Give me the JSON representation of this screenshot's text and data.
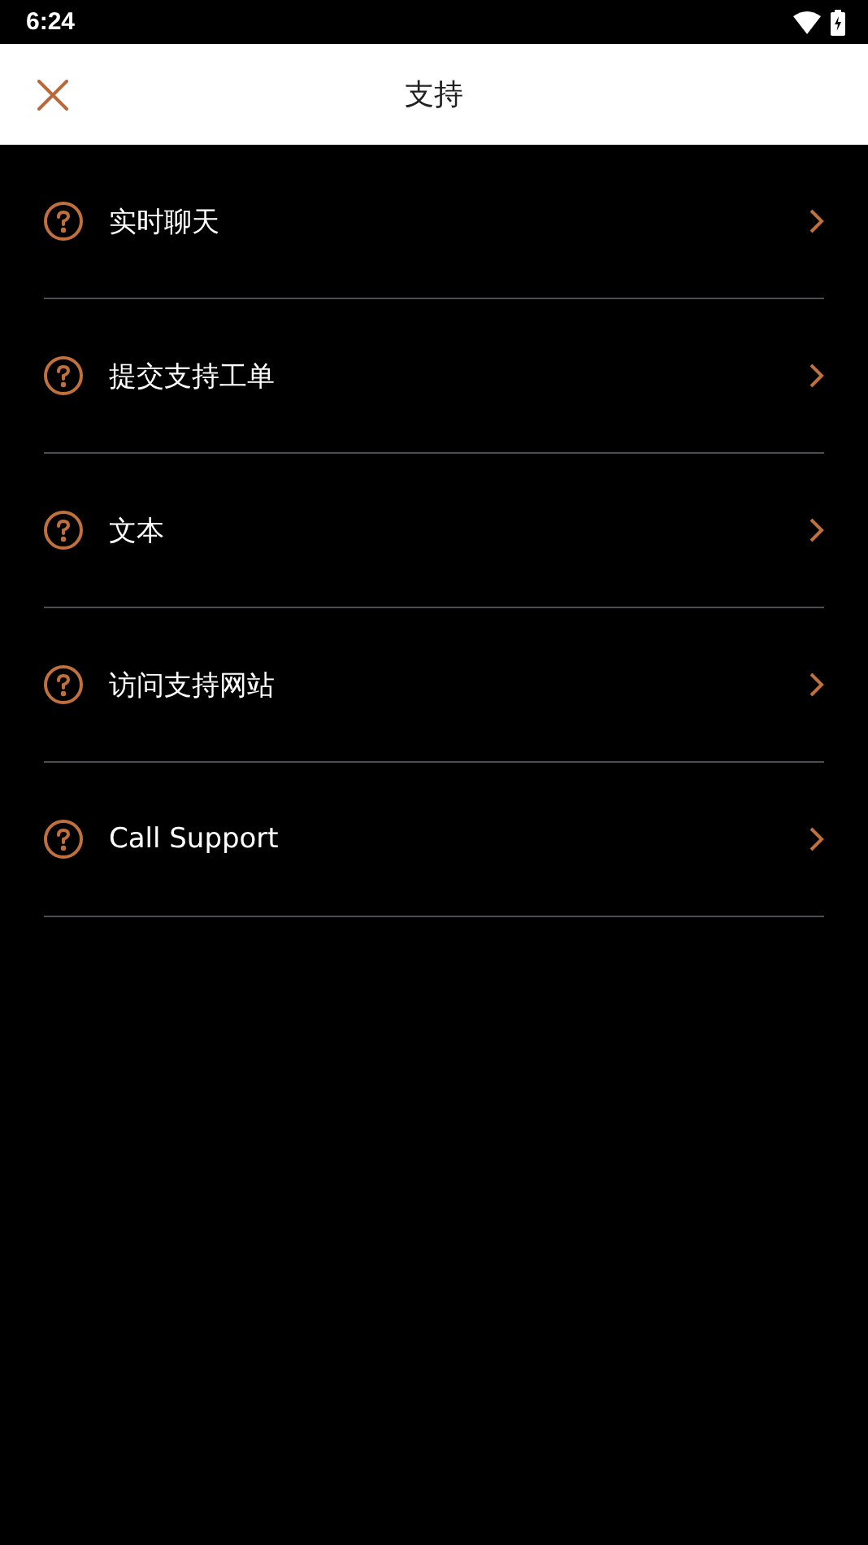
{
  "status_bar": {
    "time": "6:24"
  },
  "header": {
    "title": "支持"
  },
  "items": [
    {
      "label": "实时聊天"
    },
    {
      "label": "提交支持工单"
    },
    {
      "label": "文本"
    },
    {
      "label": "访问支持网站"
    },
    {
      "label": "Call Support"
    }
  ]
}
